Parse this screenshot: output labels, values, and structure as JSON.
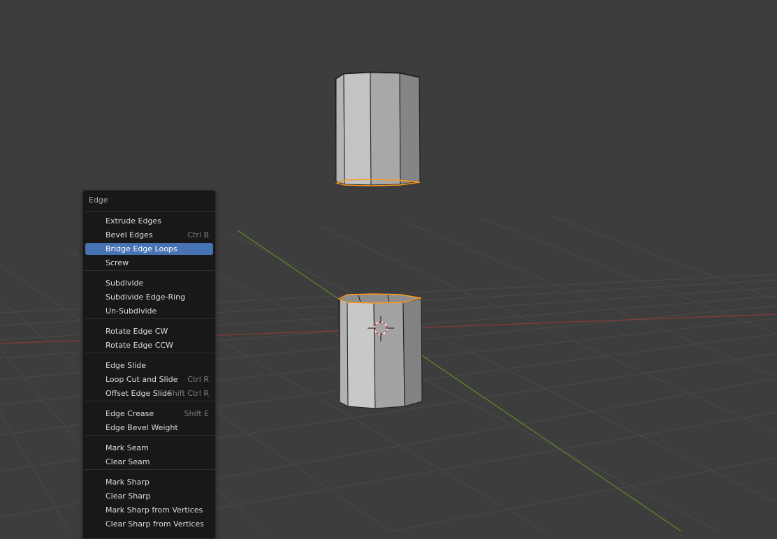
{
  "viewport": {
    "background": "#3d3d3d",
    "x_axis_color": "#8a3a3a",
    "y_axis_color": "#5f8a2a",
    "selection_color": "#ff9a1f"
  },
  "menu": {
    "title": "Edge",
    "active_color": "#4772b3",
    "groups": [
      [
        {
          "label": "Extrude Edges",
          "shortcut": ""
        },
        {
          "label": "Bevel Edges",
          "shortcut": "Ctrl B"
        },
        {
          "label": "Bridge Edge Loops",
          "shortcut": "",
          "active": true
        },
        {
          "label": "Screw",
          "shortcut": ""
        }
      ],
      [
        {
          "label": "Subdivide",
          "shortcut": ""
        },
        {
          "label": "Subdivide Edge-Ring",
          "shortcut": ""
        },
        {
          "label": "Un-Subdivide",
          "shortcut": ""
        }
      ],
      [
        {
          "label": "Rotate Edge CW",
          "shortcut": ""
        },
        {
          "label": "Rotate Edge CCW",
          "shortcut": ""
        }
      ],
      [
        {
          "label": "Edge Slide",
          "shortcut": ""
        },
        {
          "label": "Loop Cut and Slide",
          "shortcut": "Ctrl R"
        },
        {
          "label": "Offset Edge Slide",
          "shortcut": "Shift Ctrl R"
        }
      ],
      [
        {
          "label": "Edge Crease",
          "shortcut": "Shift E"
        },
        {
          "label": "Edge Bevel Weight",
          "shortcut": ""
        }
      ],
      [
        {
          "label": "Mark Seam",
          "shortcut": ""
        },
        {
          "label": "Clear Seam",
          "shortcut": ""
        }
      ],
      [
        {
          "label": "Mark Sharp",
          "shortcut": ""
        },
        {
          "label": "Clear Sharp",
          "shortcut": ""
        },
        {
          "label": "Mark Sharp from Vertices",
          "shortcut": ""
        },
        {
          "label": "Clear Sharp from Vertices",
          "shortcut": ""
        }
      ]
    ]
  }
}
